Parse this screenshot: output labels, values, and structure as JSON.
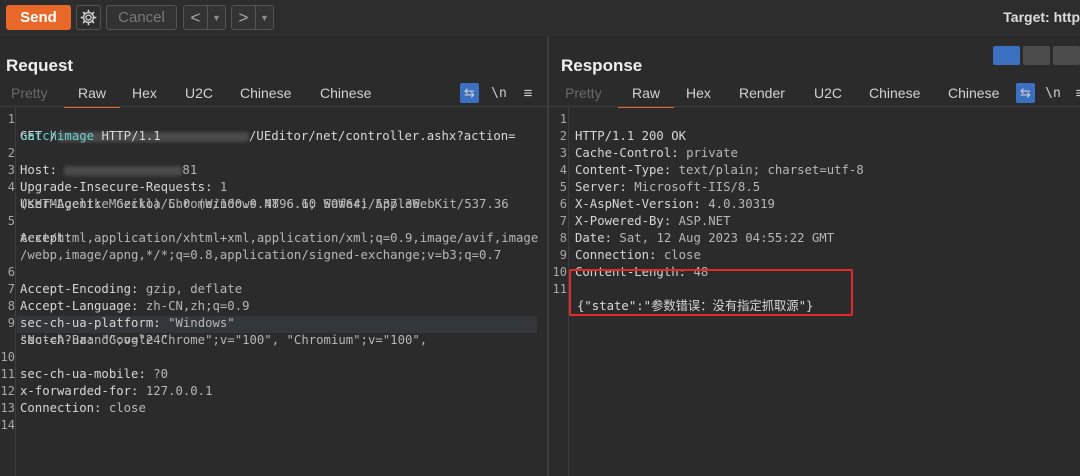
{
  "toolbar": {
    "send_label": "Send",
    "cancel_label": "Cancel",
    "back_arrow": "<",
    "fwd_arrow": ">",
    "dropdown_glyph": "▼",
    "target_label": "Target: http"
  },
  "request": {
    "title": "Request",
    "tabs": [
      "Pretty",
      "Raw",
      "Hex",
      "U2C",
      "Chinese",
      "Chinese"
    ],
    "active_tab": "Raw",
    "wrap_icon": "⇆",
    "newline_icon": "\\n",
    "menu_icon": "≡",
    "lines": {
      "l1a_pre": "GET /",
      "l1a_post": "/UEditor/net/controller.ashx?action=",
      "l1b_a": "catchimage",
      "l1b_b": " HTTP/1.1",
      "l2_key": "Host: ",
      "l2_post": "81",
      "l3_key": "Upgrade-Insecure-Requests: ",
      "l3_val": "1",
      "l4_key": "User-Agent: ",
      "l4_val": "Mozilla/5.0 (Windows NT 6.1; WOW64) AppleWebKit/537.36",
      "l4_cont": "(KHTML, like Gecko) Chrome/100.0.4896.60 Safari/537.36",
      "l5_key": "Accept:",
      "l5_c1": "text/html,application/xhtml+xml,application/xml;q=0.9,image/avif,image",
      "l5_c2": "/webp,image/apng,*/*;q=0.8,application/signed-exchange;v=b3;q=0.7",
      "l6_key": "Accept-Encoding: ",
      "l6_val": "gzip, deflate",
      "l7_key": "Accept-Language: ",
      "l7_val": "zh-CN,zh;q=0.9",
      "l8_key": "sec-ch-ua-platform: ",
      "l8_val": "\"Windows\"",
      "l9_key": "sec-ch-ua: ",
      "l9_val": "\"Google Chrome\";v=\"100\", \"Chromium\";v=\"100\",",
      "l9_cont": "\"Not=A?Brand\";v=\"24\"",
      "l10_key": "sec-ch-ua-mobile: ",
      "l10_val": "?0",
      "l11_key": "x-forwarded-for: ",
      "l11_val": "127.0.0.1",
      "l12_key": "Connection: ",
      "l12_val": "close"
    },
    "line_numbers": [
      "1",
      "2",
      "3",
      "4",
      "5",
      "6",
      "7",
      "8",
      "9",
      "10",
      "11",
      "12",
      "13",
      "14"
    ]
  },
  "response": {
    "title": "Response",
    "tabs": [
      "Pretty",
      "Raw",
      "Hex",
      "Render",
      "U2C",
      "Chinese",
      "Chinese"
    ],
    "active_tab": "Raw",
    "wrap_icon": "⇆",
    "newline_icon": "\\n",
    "menu_icon": "≡",
    "lines": {
      "l1": "HTTP/1.1 200 OK",
      "l2_key": "Cache-Control: ",
      "l2_val": "private",
      "l3_key": "Content-Type: ",
      "l3_val": "text/plain; charset=utf-8",
      "l4_key": "Server: ",
      "l4_val": "Microsoft-IIS/8.5",
      "l5_key": "X-AspNet-Version: ",
      "l5_val": "4.0.30319",
      "l6_key": "X-Powered-By: ",
      "l6_val": "ASP.NET",
      "l7_key": "Date: ",
      "l7_val": "Sat, 12 Aug 2023 04:55:22 GMT",
      "l8_key": "Connection: ",
      "l8_val": "close",
      "l9_key": "Content-Length: ",
      "l9_val": "48",
      "l11": "{\"state\":\"参数错误：没有指定抓取源\"}"
    },
    "line_numbers": [
      "1",
      "2",
      "3",
      "4",
      "5",
      "6",
      "7",
      "8",
      "9",
      "10",
      "11"
    ]
  },
  "colors": {
    "accent": "#e8682a",
    "highlight_box": "#e32a2a",
    "active_icon": "#3b6fc0"
  }
}
